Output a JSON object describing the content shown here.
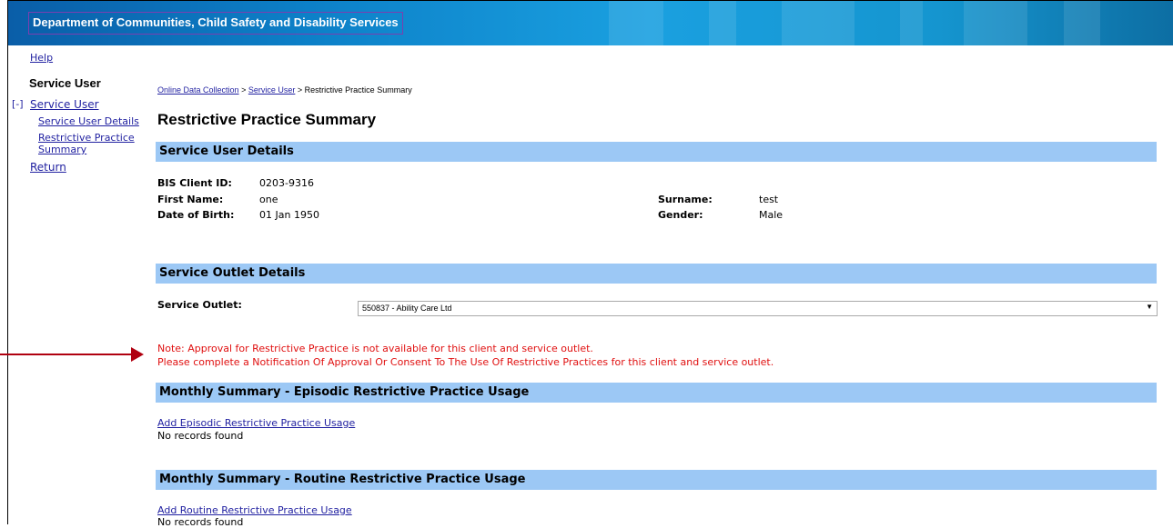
{
  "header": {
    "title": "Department of Communities, Child Safety and Disability Services"
  },
  "help": "Help",
  "sidebar": {
    "title": "Service User",
    "toggle": "[-]",
    "items": [
      {
        "label": "Service User"
      },
      {
        "label": "Service User Details"
      },
      {
        "label": "Restrictive Practice"
      },
      {
        "label": "Summary"
      },
      {
        "label": "Return"
      }
    ]
  },
  "breadcrumb": {
    "crumb1": "Online Data Collection",
    "sep1": ">",
    "crumb2": "Service User",
    "sep2": ">",
    "current": "Restrictive Practice Summary"
  },
  "page_title": "Restrictive Practice Summary",
  "service_user": {
    "heading": "Service User Details",
    "client_id_label": "BIS Client ID:",
    "client_id": "0203-9316",
    "first_name_label": "First Name:",
    "first_name": "one",
    "dob_label": "Date of Birth:",
    "dob": "01 Jan 1950",
    "surname_label": "Surname:",
    "surname": "test",
    "gender_label": "Gender:",
    "gender": "Male"
  },
  "outlet": {
    "heading": "Service Outlet Details",
    "label": "Service Outlet:",
    "selected": "550837 - Ability Care Ltd"
  },
  "note": {
    "line1": "Note: Approval for Restrictive Practice is not available for this client and service outlet.",
    "line2": "Please complete a Notification Of Approval Or Consent To The Use Of Restrictive Practices for this client and service outlet."
  },
  "episodic": {
    "heading": "Monthly Summary - Episodic Restrictive Practice Usage",
    "add_link": "Add Episodic Restrictive Practice Usage",
    "empty": "No records found"
  },
  "routine": {
    "heading": "Monthly Summary - Routine Restrictive Practice Usage",
    "add_link": "Add Routine Restrictive Practice Usage",
    "empty": "No records found"
  },
  "colors": {
    "section_bar": "#9cc8f5",
    "note_text": "#e01010",
    "link": "#1f1fa0",
    "arrow": "#b00010"
  }
}
